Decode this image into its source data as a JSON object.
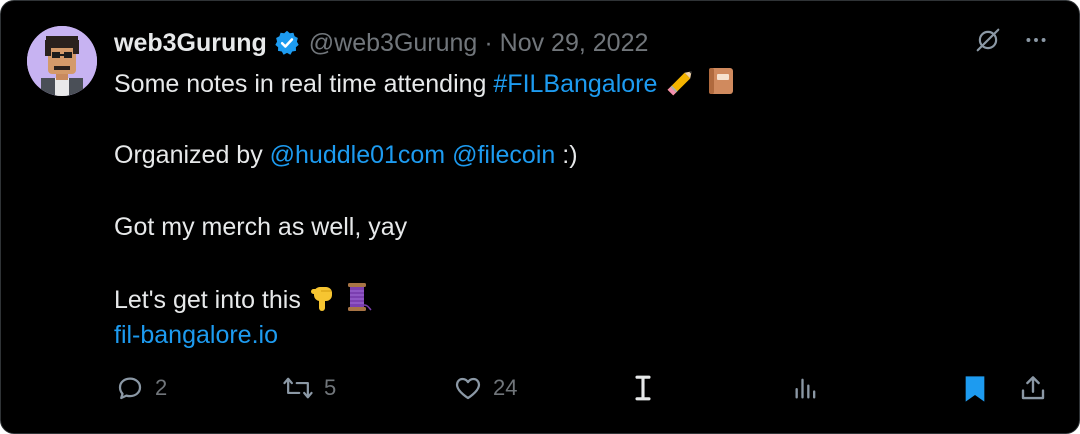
{
  "tweet": {
    "author_name": "web3Gurung",
    "handle": "@web3Gurung",
    "separator": "·",
    "date": "Nov 29, 2022",
    "line1_prefix": "Some notes in real time attending ",
    "line1_hashtag": "#FILBangalore",
    "line2_prefix": "Organized by ",
    "mention1": "@huddle01com",
    "mention2": "@filecoin",
    "line2_suffix": " :)",
    "line3": "Got my merch as well, yay",
    "line4": "Let's get into this",
    "link": "fil-bangalore.io"
  },
  "actions": {
    "reply_count": "2",
    "retweet_count": "5",
    "like_count": "24"
  },
  "icons": {
    "verified": "verified-badge-icon",
    "grok": "grok-icon",
    "more": "more-icon",
    "reply": "reply-icon",
    "retweet": "retweet-icon",
    "like": "like-icon",
    "read_mode": "read-mode-icon",
    "views": "views-icon",
    "bookmark": "bookmark-icon",
    "share": "share-icon"
  },
  "colors": {
    "background": "#000000",
    "text": "#e7e9ea",
    "muted": "#71767b",
    "link": "#1d9bf0"
  }
}
